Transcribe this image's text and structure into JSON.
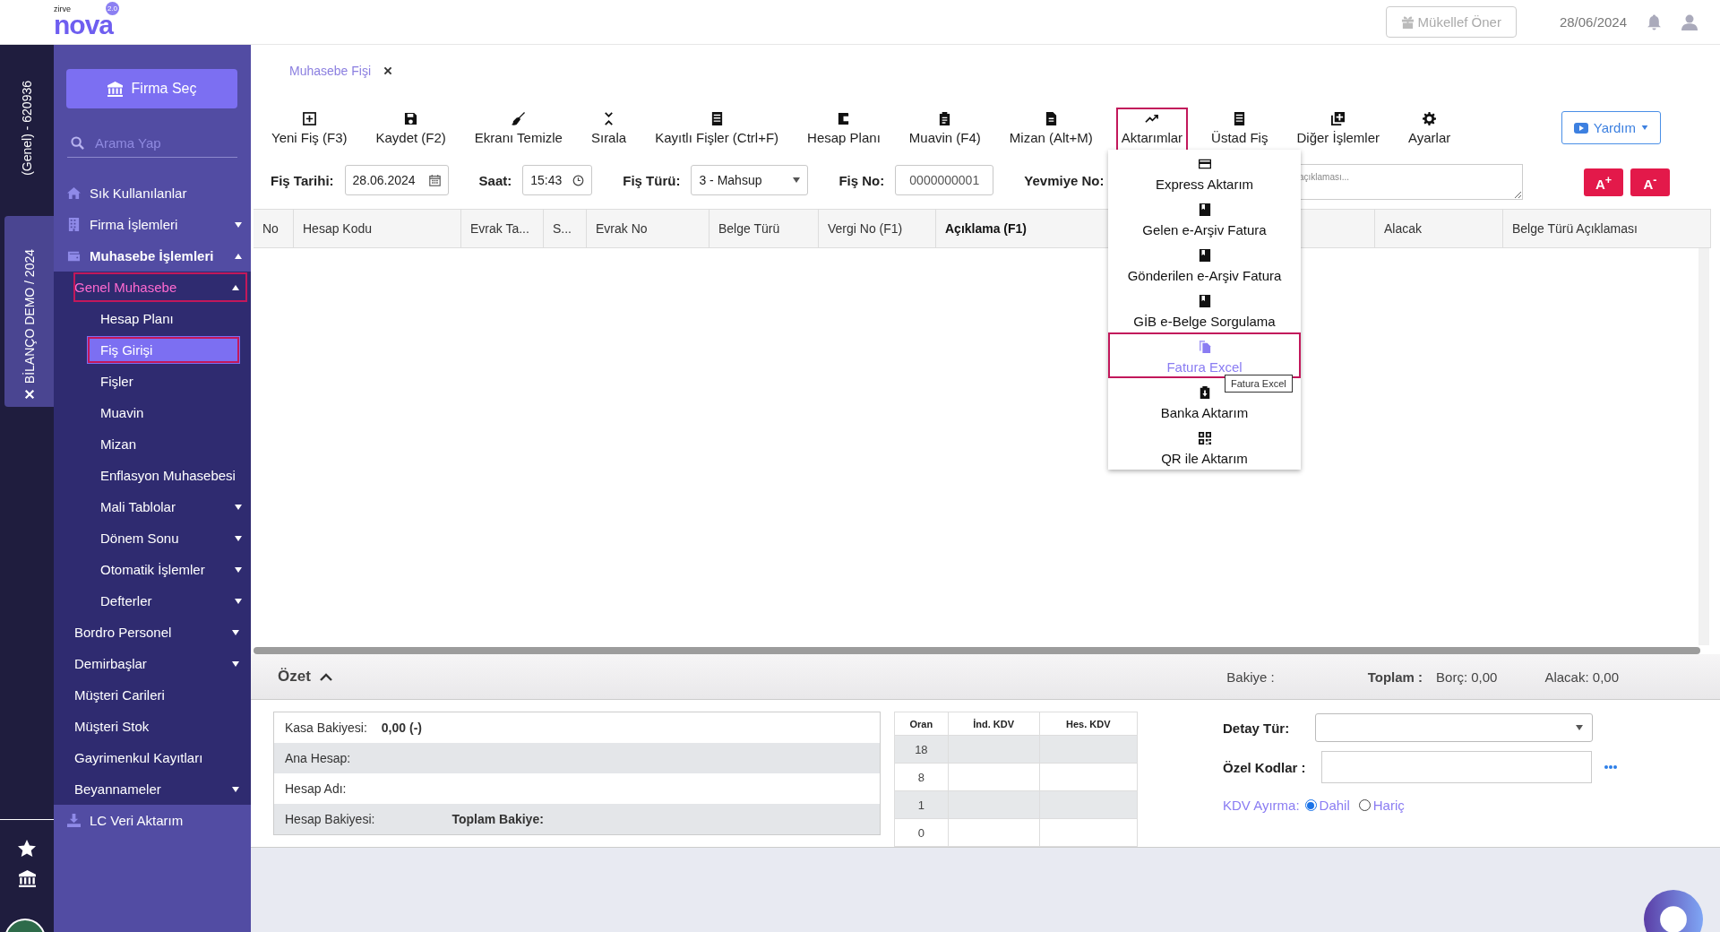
{
  "header": {
    "logo_top": "zirve",
    "logo": "nova",
    "logo_badge": "2.0",
    "suggest_button": "Mükellef Öner",
    "date": "28/06/2024"
  },
  "left_strip": {
    "company_code": "(Genel) - 620936",
    "workspace_tab": "BİLANÇO DEMO / 2024"
  },
  "sidebar": {
    "company_button": "Firma Seç",
    "search": {
      "placeholder": "Arama Yap"
    },
    "items": [
      {
        "label": "Sık Kullanılanlar",
        "selected": false,
        "highlighted": false
      },
      {
        "label": "Firma İşlemleri",
        "selected": false,
        "highlighted": false,
        "expanded": false
      },
      {
        "label": "Muhasebe İşlemleri",
        "selected": false,
        "highlighted": false,
        "expanded": true,
        "children": [
          {
            "label": "Genel Muhasebe",
            "selected": false,
            "highlighted": true,
            "expanded": true,
            "children": [
              {
                "label": "Hesap Planı",
                "selected": false,
                "highlighted": false
              },
              {
                "label": "Fiş Girişi",
                "selected": true,
                "highlighted": true
              },
              {
                "label": "Fişler",
                "selected": false,
                "highlighted": false
              },
              {
                "label": "Muavin",
                "selected": false,
                "highlighted": false
              },
              {
                "label": "Mizan",
                "selected": false,
                "highlighted": false
              },
              {
                "label": "Enflasyon Muhasebesi",
                "selected": false,
                "highlighted": false
              },
              {
                "label": "Mali Tablolar",
                "selected": false,
                "highlighted": false,
                "expanded": false
              },
              {
                "label": "Dönem Sonu",
                "selected": false,
                "highlighted": false,
                "expanded": false
              },
              {
                "label": "Otomatik İşlemler",
                "selected": false,
                "highlighted": false,
                "expanded": false
              },
              {
                "label": "Defterler",
                "selected": false,
                "highlighted": false,
                "expanded": false
              }
            ]
          },
          {
            "label": "Bordro Personel",
            "selected": false,
            "highlighted": false,
            "expanded": false
          },
          {
            "label": "Demirbaşlar",
            "selected": false,
            "highlighted": false,
            "expanded": false
          },
          {
            "label": "Müşteri Carileri",
            "selected": false,
            "highlighted": false
          },
          {
            "label": "Müşteri Stok",
            "selected": false,
            "highlighted": false
          },
          {
            "label": "Gayrimenkul Kayıtları",
            "selected": false,
            "highlighted": false
          },
          {
            "label": "Beyannameler",
            "selected": false,
            "highlighted": false,
            "expanded": false
          }
        ]
      },
      {
        "label": "LC Veri Aktarım",
        "selected": false,
        "highlighted": false
      }
    ]
  },
  "tabs": [
    {
      "label": "Muhasebe Fişi",
      "selected": true
    }
  ],
  "toolbar": [
    {
      "label": "Yeni Fiş (F3)",
      "highlighted": false
    },
    {
      "label": "Kaydet (F2)",
      "highlighted": false
    },
    {
      "label": "Ekranı Temizle",
      "highlighted": false
    },
    {
      "label": "Sırala",
      "highlighted": false
    },
    {
      "label": "Kayıtlı Fişler (Ctrl+F)",
      "highlighted": false
    },
    {
      "label": "Hesap Planı",
      "highlighted": false
    },
    {
      "label": "Muavin (F4)",
      "highlighted": false
    },
    {
      "label": "Mizan (Alt+M)",
      "highlighted": false
    },
    {
      "label": "Aktarımlar",
      "highlighted": true,
      "expanded": true,
      "menu": [
        {
          "label": "Express Aktarım",
          "highlighted": false
        },
        {
          "label": "Gelen e-Arşiv Fatura",
          "highlighted": false
        },
        {
          "label": "Gönderilen e-Arşiv Fatura",
          "highlighted": false
        },
        {
          "label": "GİB e-Belge Sorgulama",
          "highlighted": false
        },
        {
          "label": "Fatura Excel",
          "highlighted": true,
          "tooltip": "Fatura Excel"
        },
        {
          "label": "Banka Aktarım",
          "highlighted": false
        },
        {
          "label": "QR ile Aktarım",
          "highlighted": false
        }
      ]
    },
    {
      "label": "Üstad Fiş",
      "highlighted": false
    },
    {
      "label": "Diğer İşlemler",
      "highlighted": false
    },
    {
      "label": "Ayarlar",
      "highlighted": false
    }
  ],
  "help_button": "Yardım",
  "entry_form": {
    "fields": [
      {
        "kind": "date",
        "label": "Fiş Tarihi:",
        "value": "28.06.2024"
      },
      {
        "kind": "time",
        "label": "Saat:",
        "value": "15:43"
      },
      {
        "kind": "select",
        "label": "Fiş Türü:",
        "value": "3 - Mahsup"
      },
      {
        "kind": "text",
        "label": "Fiş No:",
        "value": "0000000001"
      },
      {
        "kind": "text",
        "label": "Yevmiye No:"
      }
    ],
    "description": {
      "placeholder": "açıklaması..."
    },
    "font_buttons": [
      "A$^{+}$",
      "A$^{-}$"
    ]
  },
  "table": {
    "columns": [
      {
        "label": "No",
        "emphasis": false
      },
      {
        "label": "Hesap Kodu",
        "emphasis": false
      },
      {
        "label": "Evrak Ta...",
        "emphasis": false
      },
      {
        "label": "S...",
        "emphasis": false
      },
      {
        "label": "Evrak No",
        "emphasis": false
      },
      {
        "label": "Belge Türü",
        "emphasis": false
      },
      {
        "label": "Vergi No (F1)",
        "emphasis": false
      },
      {
        "label": "Açıklama (F1)",
        "emphasis": true
      },
      {
        "label": "Alacak",
        "emphasis": false
      },
      {
        "label": "Belge Türü Açıklaması",
        "emphasis": false
      }
    ]
  },
  "summary": {
    "title": "Özet",
    "expanded": true,
    "totals": {
      "balance_label": "Bakiye :",
      "total_label": "Toplam :",
      "debit": "Borç: 0,00",
      "credit": "Alacak: 0,00"
    },
    "info_rows": [
      {
        "label": "Kasa Bakiyesi:",
        "value": "0,00 (-)"
      },
      {
        "label": "Ana Hesap:"
      },
      {
        "label": "Hesap Adı:"
      },
      {
        "label": "Hesap Bakiyesi:",
        "extra_label": "Toplam Bakiye:"
      }
    ],
    "kdv_table": {
      "columns": [
        "Oran",
        "İnd. KDV",
        "Hes. KDV"
      ],
      "rows": [
        [
          "18"
        ],
        [
          "8"
        ],
        [
          "1"
        ],
        [
          "0"
        ]
      ]
    },
    "detail": {
      "type_label": "Detay Tür:",
      "codes_label": "Özel Kodlar :",
      "vat_label": "KDV Ayırma:",
      "vat_options": [
        {
          "label": "Dahil",
          "selected": true
        },
        {
          "label": "Hariç",
          "selected": false
        }
      ]
    }
  }
}
